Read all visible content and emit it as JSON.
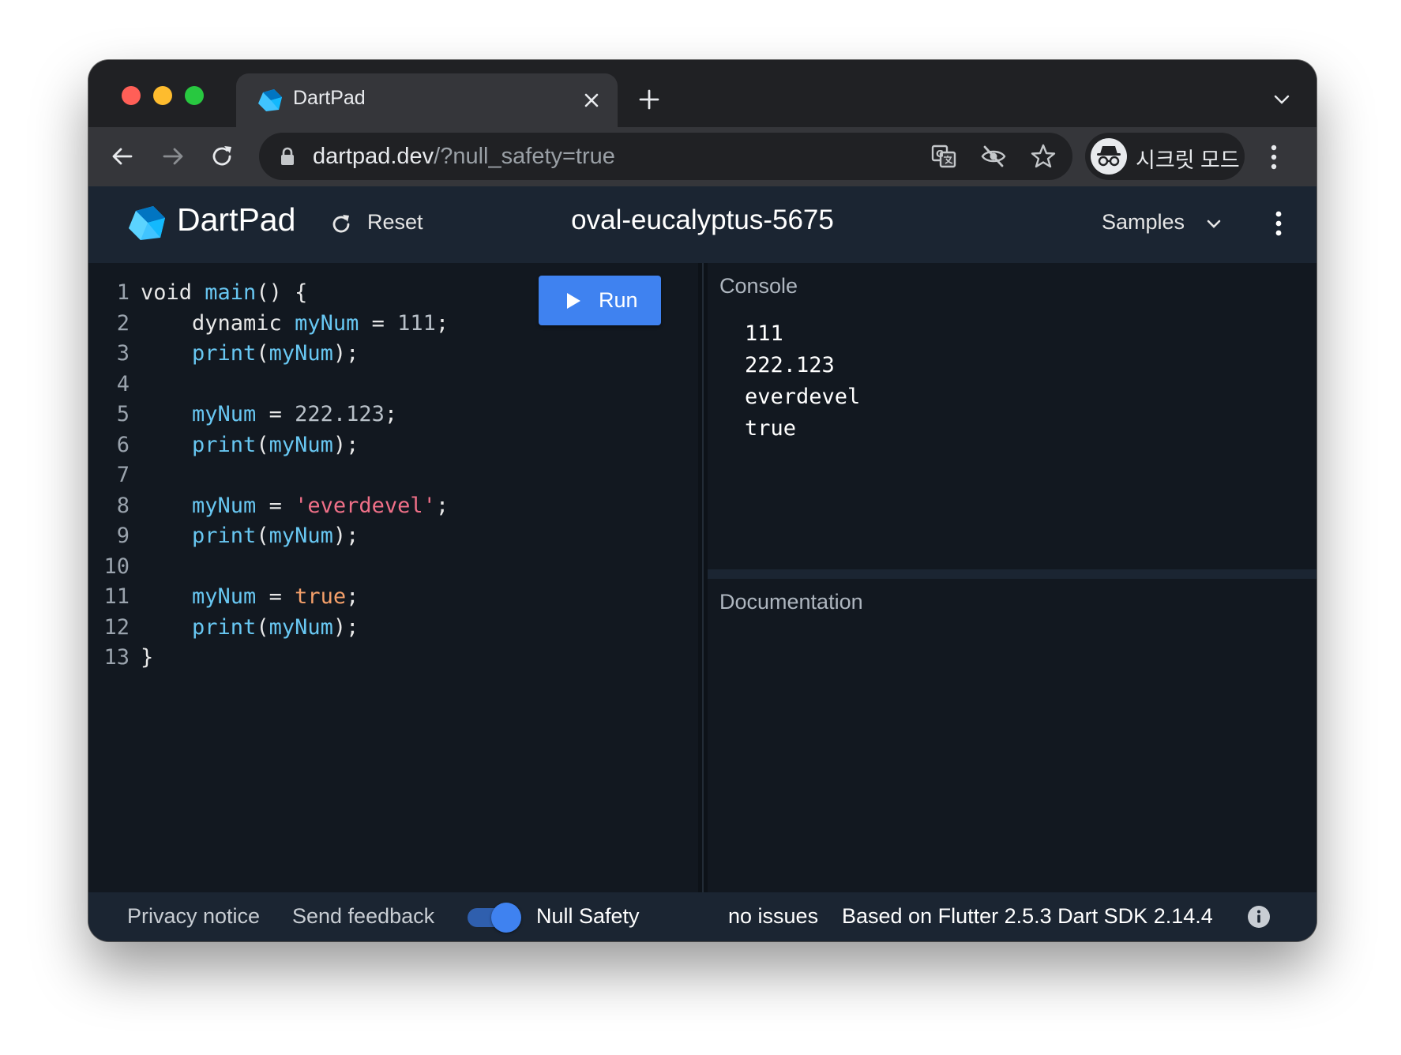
{
  "browser": {
    "tab_title": "DartPad",
    "url_host": "dartpad.dev",
    "url_path": "/?null_safety=true",
    "incognito_label": "시크릿 모드",
    "icons": {
      "back": "arrow-left-icon",
      "forward": "arrow-right-icon",
      "reload": "reload-icon",
      "lock": "lock-icon",
      "translate": "translate-icon",
      "tracking": "eye-off-icon",
      "bookmark": "star-icon",
      "incognito": "incognito-icon",
      "menu": "more-vertical-icon"
    }
  },
  "app": {
    "brand": "DartPad",
    "reset_label": "Reset",
    "gist_title": "oval-eucalyptus-5675",
    "samples_label": "Samples",
    "run_label": "Run",
    "colors": {
      "run_button": "#3f82f0",
      "identifier": "#68c7f2",
      "string": "#f07088",
      "boolean": "#f5a06a"
    }
  },
  "editor": {
    "lines": [
      {
        "n": "1",
        "tokens": [
          [
            "t-kw",
            "void "
          ],
          [
            "t-id",
            "main"
          ],
          [
            "t-p",
            "() {"
          ]
        ]
      },
      {
        "n": "2",
        "tokens": [
          [
            "t-kw",
            "    dynamic "
          ],
          [
            "t-id",
            "myNum"
          ],
          [
            "t-p",
            " = "
          ],
          [
            "t-num",
            "111"
          ],
          [
            "t-p",
            ";"
          ]
        ]
      },
      {
        "n": "3",
        "tokens": [
          [
            "t-id",
            "    print"
          ],
          [
            "t-p",
            "("
          ],
          [
            "t-id",
            "myNum"
          ],
          [
            "t-p",
            ");"
          ]
        ]
      },
      {
        "n": "4",
        "tokens": []
      },
      {
        "n": "5",
        "tokens": [
          [
            "t-id",
            "    myNum"
          ],
          [
            "t-p",
            " = "
          ],
          [
            "t-num",
            "222.123"
          ],
          [
            "t-p",
            ";"
          ]
        ]
      },
      {
        "n": "6",
        "tokens": [
          [
            "t-id",
            "    print"
          ],
          [
            "t-p",
            "("
          ],
          [
            "t-id",
            "myNum"
          ],
          [
            "t-p",
            ");"
          ]
        ]
      },
      {
        "n": "7",
        "tokens": []
      },
      {
        "n": "8",
        "tokens": [
          [
            "t-id",
            "    myNum"
          ],
          [
            "t-p",
            " = "
          ],
          [
            "t-str",
            "'everdevel'"
          ],
          [
            "t-p",
            ";"
          ]
        ]
      },
      {
        "n": "9",
        "tokens": [
          [
            "t-id",
            "    print"
          ],
          [
            "t-p",
            "("
          ],
          [
            "t-id",
            "myNum"
          ],
          [
            "t-p",
            ");"
          ]
        ]
      },
      {
        "n": "10",
        "tokens": []
      },
      {
        "n": "11",
        "tokens": [
          [
            "t-id",
            "    myNum"
          ],
          [
            "t-p",
            " = "
          ],
          [
            "t-bool",
            "true"
          ],
          [
            "t-p",
            ";"
          ]
        ]
      },
      {
        "n": "12",
        "tokens": [
          [
            "t-id",
            "    print"
          ],
          [
            "t-p",
            "("
          ],
          [
            "t-id",
            "myNum"
          ],
          [
            "t-p",
            ");"
          ]
        ]
      },
      {
        "n": "13",
        "tokens": [
          [
            "t-p",
            "}"
          ]
        ]
      }
    ]
  },
  "console": {
    "title": "Console",
    "output": [
      "111",
      "222.123",
      "everdevel",
      "true"
    ]
  },
  "docs": {
    "title": "Documentation"
  },
  "status": {
    "privacy": "Privacy notice",
    "feedback": "Send feedback",
    "null_safety_label": "Null Safety",
    "null_safety_on": true,
    "issues": "no issues",
    "version": "Based on Flutter 2.5.3 Dart SDK 2.14.4"
  }
}
